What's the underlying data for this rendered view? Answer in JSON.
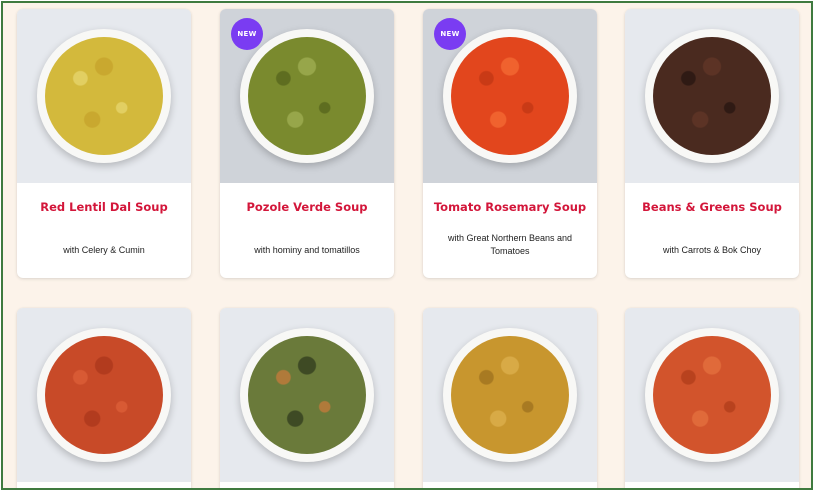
{
  "products": [
    {
      "title": "Red Lentil Dal Soup",
      "subtitle": "with Celery & Cumin",
      "badge": "",
      "soup_colors": [
        "#d3b93c",
        "#c9a82f",
        "#e2cf62"
      ],
      "background": "#e6e9ee"
    },
    {
      "title": "Pozole Verde Soup",
      "subtitle": "with hominy and tomatillos",
      "badge": "NEW",
      "soup_colors": [
        "#7a8a2e",
        "#97a64a",
        "#5e6d20"
      ],
      "background": "#cfd3d9"
    },
    {
      "title": "Tomato Rosemary Soup",
      "subtitle": "with Great Northern Beans and Tomatoes",
      "badge": "NEW",
      "soup_colors": [
        "#e2461d",
        "#f0622e",
        "#c93a16"
      ],
      "background": "#cfd3d9"
    },
    {
      "title": "Beans & Greens Soup",
      "subtitle": "with Carrots & Bok Choy",
      "badge": "",
      "soup_colors": [
        "#4a2a1f",
        "#5c3325",
        "#2f1a14"
      ],
      "background": "#e6e9ee"
    },
    {
      "title": "",
      "subtitle": "",
      "badge": "",
      "soup_colors": [
        "#c84a28",
        "#b23b1e",
        "#d85a34"
      ],
      "background": "#e6e9ee"
    },
    {
      "title": "",
      "subtitle": "",
      "badge": "",
      "soup_colors": [
        "#6a7a3a",
        "#3e4a24",
        "#b07a3a"
      ],
      "background": "#e6e9ee"
    },
    {
      "title": "",
      "subtitle": "",
      "badge": "",
      "soup_colors": [
        "#c8962e",
        "#d8aa46",
        "#a87a22"
      ],
      "background": "#e6e9ee"
    },
    {
      "title": "",
      "subtitle": "",
      "badge": "",
      "soup_colors": [
        "#d2542c",
        "#e06a3a",
        "#b8421e"
      ],
      "background": "#e6e9ee"
    }
  ]
}
